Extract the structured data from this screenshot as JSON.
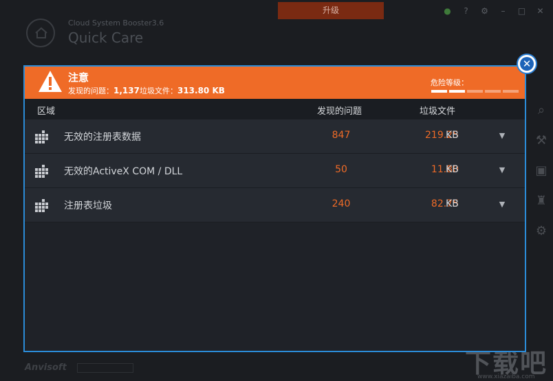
{
  "background": {
    "upgrade_button": "升级",
    "app_name": "Cloud System Booster3.6",
    "page_title": "Quick Care",
    "brand": "Anvisoft",
    "watermark": "下载吧",
    "watermark_url": "www.xiazaiba.com"
  },
  "dialog": {
    "title": "注意",
    "summary_issues_label": "发现的问题：",
    "summary_issues_value": "1,137",
    "summary_junk_label": "垃圾文件：",
    "summary_junk_value": "313.80 KB",
    "risk_label": "危险等级：",
    "risk_level": 2,
    "risk_max": 5,
    "columns": {
      "area": "区域",
      "issues": "发现的问题",
      "junk": "垃圾文件"
    },
    "rows": [
      {
        "name": "无效的注册表数据",
        "count": "847",
        "size": "219.25",
        "unit": "KB"
      },
      {
        "name": "无效的ActiveX COM / DLL",
        "count": "50",
        "size": "11.80",
        "unit": "KB"
      },
      {
        "name": "注册表垃圾",
        "count": "240",
        "size": "82.75",
        "unit": "KB"
      }
    ]
  },
  "colors": {
    "accent": "#ef6b27",
    "frame": "#2b8cd8",
    "panel": "#1f2228"
  }
}
